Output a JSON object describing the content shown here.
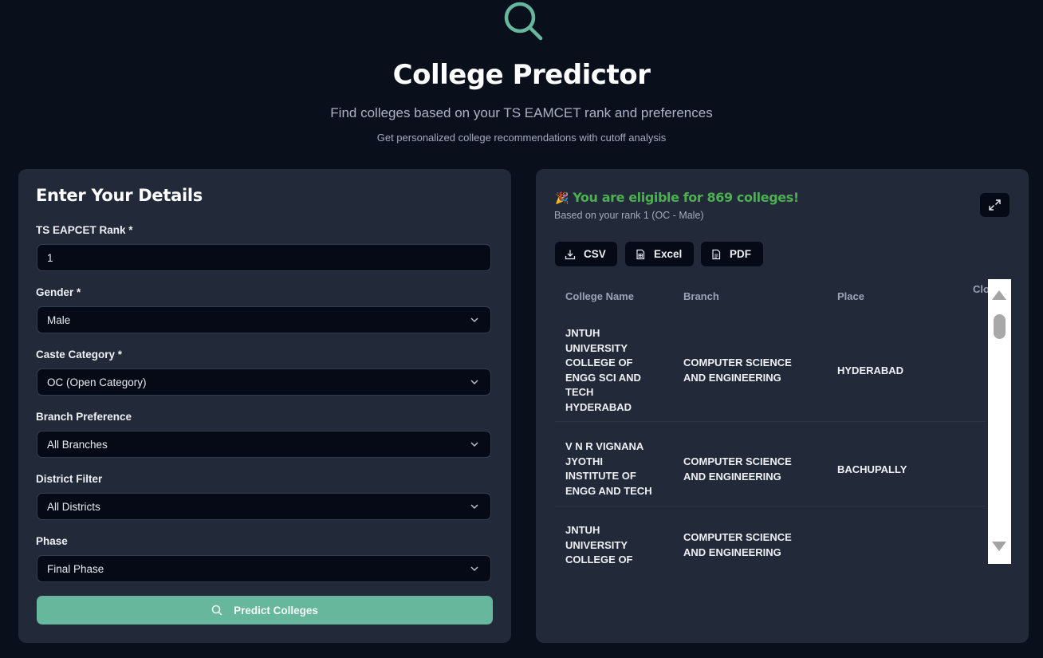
{
  "header": {
    "title": "College Predictor",
    "subtitle": "Find colleges based on your TS EAMCET rank and preferences",
    "tagline": "Get personalized college recommendations with cutoff analysis"
  },
  "form": {
    "title": "Enter Your Details",
    "rank": {
      "label": "TS EAPCET Rank *",
      "value": "1"
    },
    "gender": {
      "label": "Gender *",
      "value": "Male"
    },
    "caste": {
      "label": "Caste Category *",
      "value": "OC (Open Category)"
    },
    "branch": {
      "label": "Branch Preference",
      "value": "All Branches"
    },
    "district": {
      "label": "District Filter",
      "value": "All Districts"
    },
    "phase": {
      "label": "Phase",
      "value": "Final Phase"
    },
    "submit_label": "Predict Colleges"
  },
  "results": {
    "emoji": "🎉",
    "eligible_text": "You are eligible for 869 colleges!",
    "based_on": "Based on your rank 1 (OC - Male)",
    "export": {
      "csv": "CSV",
      "excel": "Excel",
      "pdf": "PDF"
    },
    "columns": [
      "College Name",
      "Branch",
      "Place",
      "Clo"
    ],
    "rows": [
      {
        "college": [
          "JNTUH",
          "UNIVERSITY",
          "COLLEGE OF",
          "ENGG SCI AND",
          "TECH",
          "HYDERABAD"
        ],
        "branch": [
          "COMPUTER SCIENCE",
          "AND ENGINEERING"
        ],
        "place": "HYDERABAD"
      },
      {
        "college": [
          "V N R VIGNANA",
          "JYOTHI",
          "INSTITUTE OF",
          "ENGG AND TECH"
        ],
        "branch": [
          "COMPUTER SCIENCE",
          "AND ENGINEERING"
        ],
        "place": "BACHUPALLY"
      },
      {
        "college": [
          "JNTUH",
          "UNIVERSITY",
          "COLLEGE OF"
        ],
        "branch": [
          "COMPUTER SCIENCE",
          "AND ENGINEERING"
        ],
        "place": ""
      }
    ]
  },
  "icons": {
    "hero": "search-icon",
    "expand": "expand-icon",
    "csv": "download-icon",
    "excel": "spreadsheet-icon",
    "pdf": "document-icon",
    "chevron": "chevron-down-icon"
  },
  "colors": {
    "background": "#0a0f1c",
    "card": "#222939",
    "accent": "#66b79c",
    "success": "#4caf50"
  }
}
